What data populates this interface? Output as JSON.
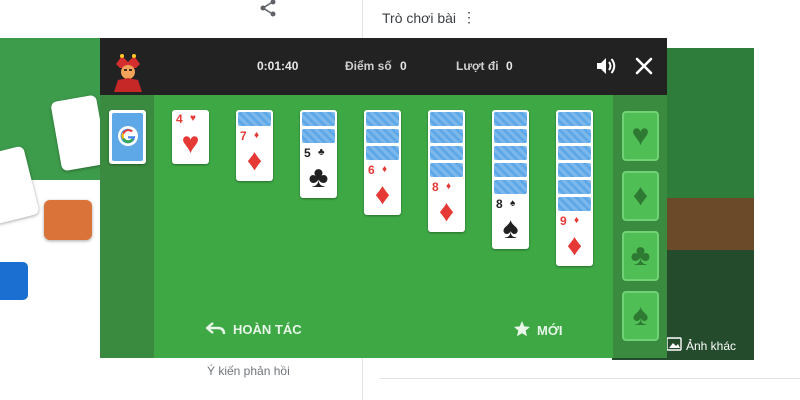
{
  "background": {
    "right_panel_title": "Trò chơi bài",
    "more_icon": "more-vert-icon",
    "feedback_link": "Ý kiến phản hồi",
    "more_images_label": "Ảnh khác"
  },
  "game": {
    "stats": {
      "time": "0:01:40",
      "score_label": "Điểm số",
      "score_value": "0",
      "moves_label": "Lượt đi",
      "moves_value": "0"
    },
    "icons": {
      "sound": "volume-icon",
      "close": "close-icon",
      "mascot": "jester-mascot-icon"
    },
    "stock": {
      "label": "G"
    },
    "tableau": [
      {
        "hidden": 0,
        "rank": "4",
        "suit": "♥",
        "color": "red"
      },
      {
        "hidden": 1,
        "rank": "7",
        "suit": "♦",
        "color": "red"
      },
      {
        "hidden": 2,
        "rank": "5",
        "suit": "♣",
        "color": "black"
      },
      {
        "hidden": 3,
        "rank": "6",
        "suit": "♦",
        "color": "red"
      },
      {
        "hidden": 4,
        "rank": "8",
        "suit": "♦",
        "color": "red"
      },
      {
        "hidden": 5,
        "rank": "8",
        "suit": "♠",
        "color": "black"
      },
      {
        "hidden": 6,
        "rank": "9",
        "suit": "♦",
        "color": "red"
      }
    ],
    "foundations": [
      {
        "suit": "♥"
      },
      {
        "suit": "♦"
      },
      {
        "suit": "♣"
      },
      {
        "suit": "♠"
      }
    ],
    "buttons": {
      "undo_label": "HOÀN TÁC",
      "new_label": "MỚI"
    },
    "colors": {
      "table": "#3ea845",
      "side_columns": "#3a8b3f",
      "top_bar": "#222222",
      "card_back": "#5fa8e8",
      "red_suit": "#e53935"
    }
  }
}
